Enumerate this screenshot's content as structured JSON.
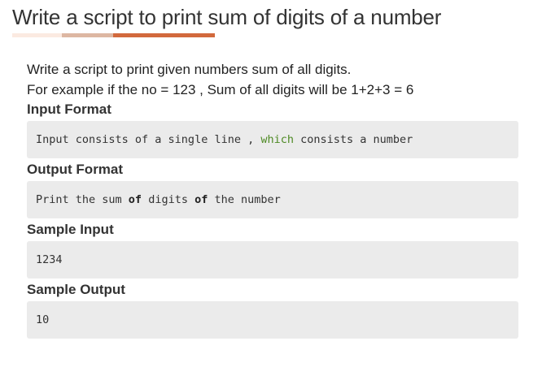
{
  "title": "Write a script to print sum of digits of a number",
  "colors": {
    "underline_light": "#fbeae1",
    "underline_mid": "#ddb7a2",
    "underline_dark": "#d2693c",
    "code_background": "#ebebeb",
    "keyword_green": "#4e8a24"
  },
  "description": {
    "line1": "Write a script to print given numbers sum of all digits.",
    "line2": "For example if the no = 123 , Sum of all digits will be 1+2+3 = 6"
  },
  "input_format": {
    "heading": "Input Format",
    "part1": "Input consists of a single line , ",
    "keyword": "which",
    "part2": " consists a number"
  },
  "output_format": {
    "heading": "Output Format",
    "part1": "Print the sum ",
    "kw1": "of",
    "part2": " digits ",
    "kw2": "of",
    "part3": " the number"
  },
  "sample_input": {
    "heading": "Sample Input",
    "value": "1234"
  },
  "sample_output": {
    "heading": "Sample Output",
    "value": "10"
  }
}
